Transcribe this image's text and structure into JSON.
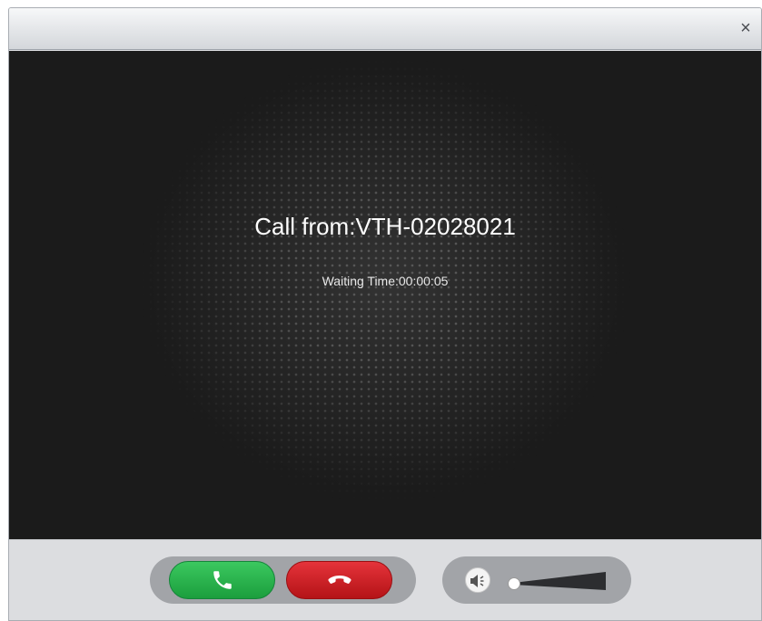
{
  "window": {
    "close_glyph": "×"
  },
  "call": {
    "caller_label": "Call from:VTH-02028021",
    "waiting_label": "Waiting Time:00:00:05"
  },
  "controls": {
    "answer_icon": "phone-answer-icon",
    "hangup_icon": "phone-hangup-icon",
    "speaker_icon": "speaker-icon",
    "volume_level": 0.0,
    "answer_color": "#2fb552",
    "hangup_color": "#d42026"
  }
}
